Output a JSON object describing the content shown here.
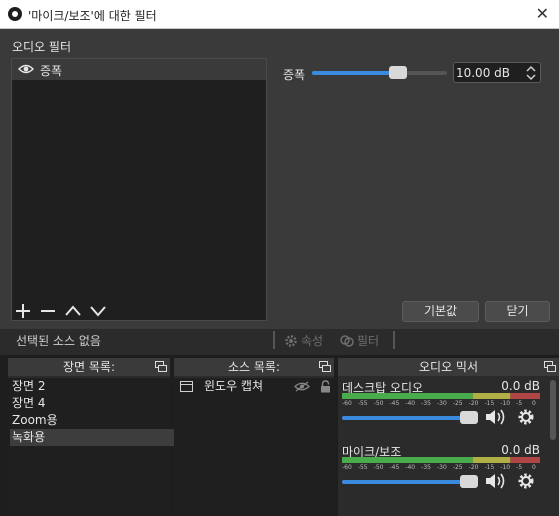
{
  "window": {
    "title": "'마이크/보조'에 대한 필터",
    "close_glyph": "✕"
  },
  "dialog": {
    "audio_filters_label": "오디오 필터",
    "filters": [
      {
        "name": "증폭"
      }
    ],
    "gain": {
      "label": "증폭",
      "value_text": "10.00 dB",
      "level": 0.66
    },
    "buttons": {
      "defaults": "기본값",
      "close": "닫기"
    }
  },
  "context_bar": {
    "no_source_selected": "선택된 소스 없음",
    "properties": "속성",
    "filters": "필터"
  },
  "scenes": {
    "title": "장면 목록:",
    "items": [
      "장면 2",
      "장면 4",
      "Zoom용",
      "녹화용"
    ],
    "selected_index": 3
  },
  "sources": {
    "title": "소스 목록:",
    "items": [
      {
        "name": "윈도우 캡쳐"
      }
    ]
  },
  "mixer": {
    "title": "오디오 믹서",
    "ticks": [
      "-60",
      "-55",
      "-50",
      "-45",
      "-40",
      "-35",
      "-30",
      "-25",
      "-20",
      "-15",
      "-10",
      "-5",
      "0"
    ],
    "channels": [
      {
        "name": "데스크탑 오디오",
        "db": "0.0 dB",
        "volume": 1.0
      },
      {
        "name": "마이크/보조",
        "db": "0.0 dB",
        "volume": 1.0
      }
    ]
  },
  "colors": {
    "accent": "#3a8be0",
    "meter_green": "#4fc24f",
    "meter_yellow": "#c8c84a",
    "meter_red": "#c84a4a"
  }
}
